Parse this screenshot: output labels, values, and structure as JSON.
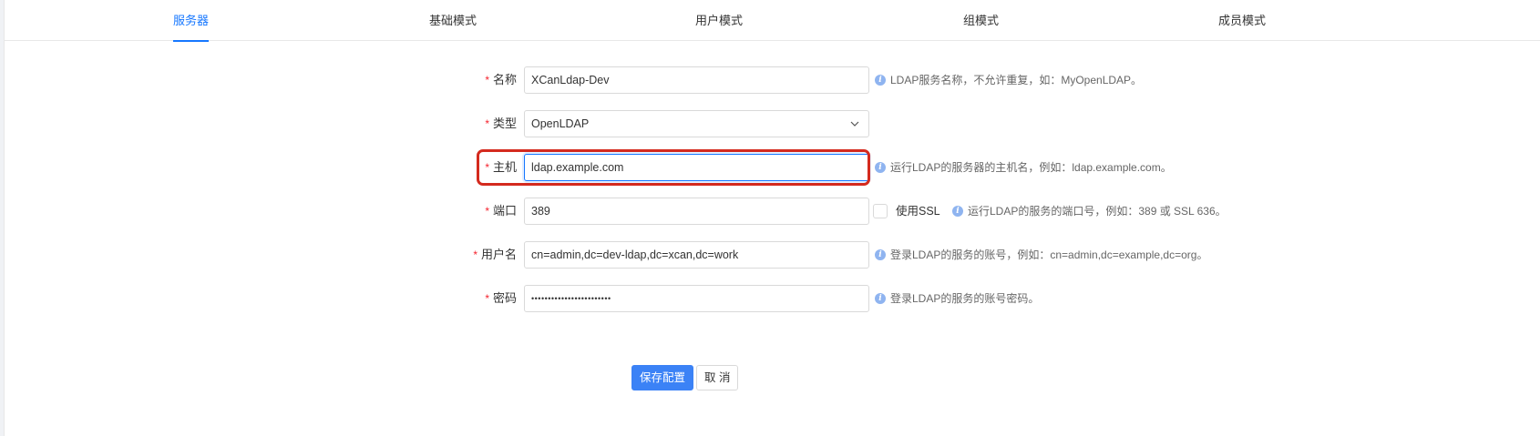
{
  "tabs": [
    {
      "label": "服务器",
      "active": true
    },
    {
      "label": "基础模式",
      "active": false
    },
    {
      "label": "用户模式",
      "active": false
    },
    {
      "label": "组模式",
      "active": false
    },
    {
      "label": "成员模式",
      "active": false
    }
  ],
  "form": {
    "required_mark": "*",
    "name": {
      "label": "名称",
      "value": "XCanLdap-Dev",
      "hint": "LDAP服务名称，不允许重复，如：MyOpenLDAP。"
    },
    "type": {
      "label": "类型",
      "value": "OpenLDAP"
    },
    "host": {
      "label": "主机",
      "value": "ldap.example.com",
      "hint": "运行LDAP的服务器的主机名，例如：ldap.example.com。"
    },
    "port": {
      "label": "端口",
      "value": "389",
      "ssl_label": "使用SSL",
      "ssl_checked": false,
      "hint": "运行LDAP的服务的端口号，例如：389 或 SSL 636。"
    },
    "username": {
      "label": "用户名",
      "value": "cn=admin,dc=dev-ldap,dc=xcan,dc=work",
      "hint": "登录LDAP的服务的账号，例如：cn=admin,dc=example,dc=org。"
    },
    "password": {
      "label": "密码",
      "value": "••••••••••••••••••••••••",
      "hint": "登录LDAP的服务的账号密码。"
    }
  },
  "buttons": {
    "save": "保存配置",
    "cancel": "取 消"
  },
  "colors": {
    "accent": "#1677ff",
    "highlight_border": "#d42a1e",
    "required": "#f5222d"
  },
  "icons": {
    "hint": "info-icon",
    "select": "chevron-down-icon"
  }
}
